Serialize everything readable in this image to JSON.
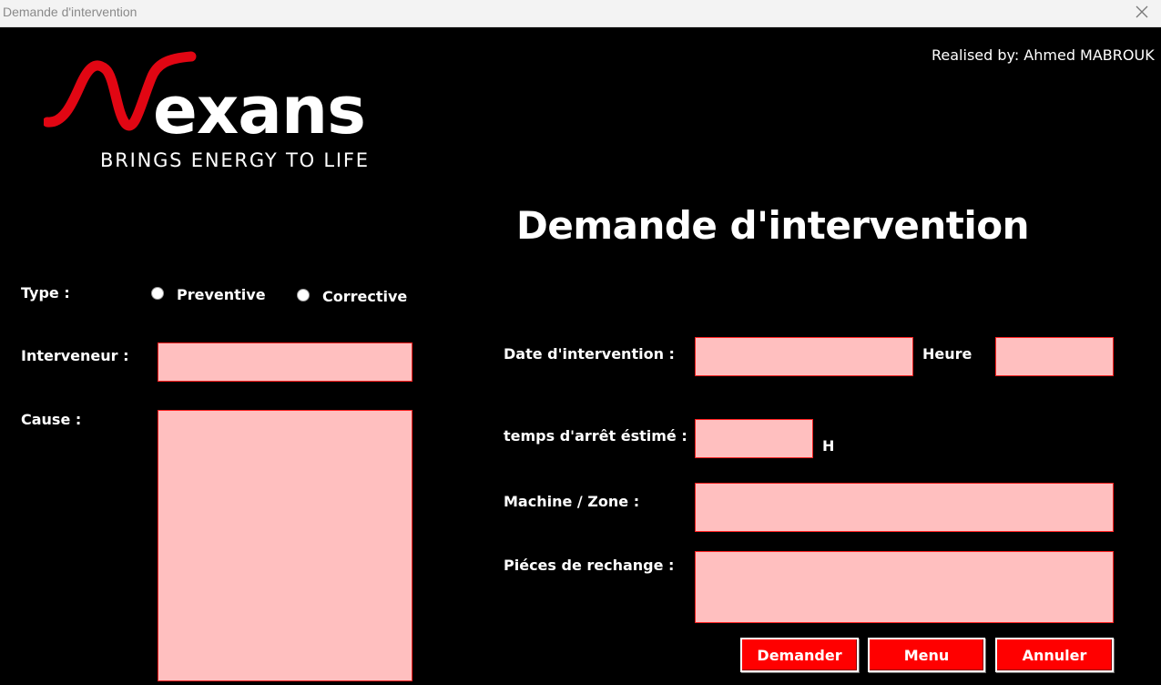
{
  "window": {
    "title": "Demande d'intervention"
  },
  "credit": "Realised by: Ahmed MABROUK",
  "logo": {
    "wordmark": "Nexans",
    "tagline": "BRINGS ENERGY TO LIFE",
    "brand_color": "#e10613"
  },
  "form": {
    "title": "Demande d'intervention",
    "type_label": "Type :",
    "type_options": [
      "Preventive",
      "Corrective"
    ],
    "intervenant_label": "Interveneur :",
    "intervenant_value": "",
    "cause_label": "Cause :",
    "cause_value": "",
    "date_label": "Date d'intervention :",
    "date_value": "",
    "heure_label": "Heure",
    "heure_value": "",
    "temps_label": "temps d'arrêt éstimé :",
    "temps_value": "",
    "temps_unit": "H",
    "machine_label": "Machine / Zone :",
    "machine_value": "",
    "pieces_label": "Piéces de rechange :",
    "pieces_value": ""
  },
  "buttons": {
    "demander": "Demander",
    "menu": "Menu",
    "annuler": "Annuler"
  },
  "colors": {
    "background": "#000000",
    "field_fill": "#ffbfbf",
    "field_border": "#ff2020",
    "button_fill": "#ff0000"
  }
}
